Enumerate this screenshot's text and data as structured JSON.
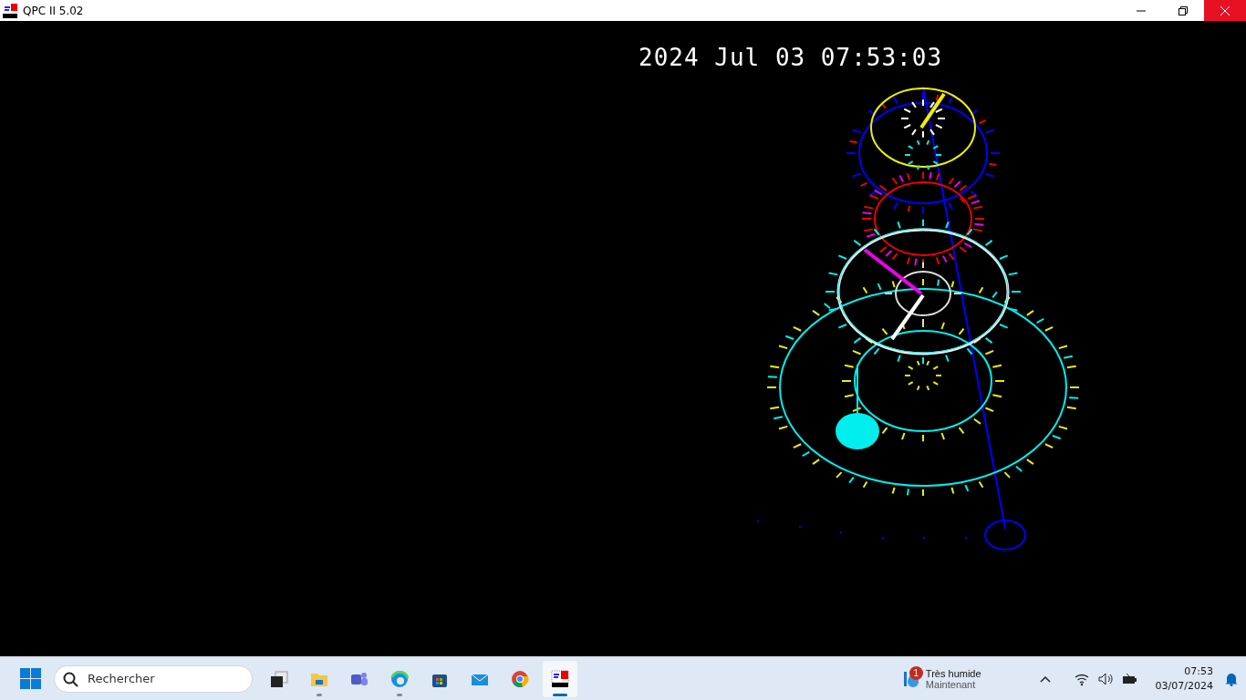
{
  "window": {
    "title": "QPC II 5.02"
  },
  "screen": {
    "timestamp": "2024 Jul 03 07:53:03"
  },
  "taskbar": {
    "search": {
      "placeholder": "Rechercher"
    },
    "apps": [
      {
        "kind": "taskview",
        "open": false,
        "selected": false
      },
      {
        "kind": "folder",
        "open": true,
        "selected": false
      },
      {
        "kind": "teams",
        "open": false,
        "selected": false
      },
      {
        "kind": "edge",
        "open": true,
        "selected": false
      },
      {
        "kind": "store",
        "open": false,
        "selected": false
      },
      {
        "kind": "mail",
        "open": false,
        "selected": false
      },
      {
        "kind": "chrome",
        "open": false,
        "selected": false
      },
      {
        "kind": "qpc",
        "open": true,
        "selected": true
      }
    ],
    "weather": {
      "badge": "1",
      "title": "Très humide",
      "subtitle": "Maintenant"
    },
    "clock": {
      "time": "07:53",
      "date": "03/07/2024"
    }
  }
}
